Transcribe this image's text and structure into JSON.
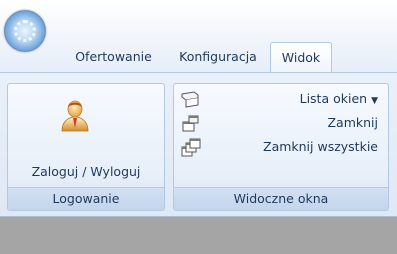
{
  "app": {
    "orb_icon": "app-orb-icon"
  },
  "tabs": [
    {
      "label": "Ofertowanie",
      "active": false
    },
    {
      "label": "Konfiguracja",
      "active": false
    },
    {
      "label": "Widok",
      "active": true
    }
  ],
  "groups": {
    "logowanie": {
      "title": "Logowanie",
      "button_label": "Zaloguj / Wyloguj",
      "icon": "user-icon"
    },
    "widoczne_okna": {
      "title": "Widoczne okna",
      "items": [
        {
          "label": "Lista okien",
          "icon": "window-list-icon",
          "has_dropdown": true
        },
        {
          "label": "Zamknij",
          "icon": "close-window-icon"
        },
        {
          "label": "Zamknij wszystkie",
          "icon": "close-all-windows-icon"
        }
      ]
    }
  },
  "colors": {
    "text": "#1e395b",
    "ribbon_bg": "#dfe8f5",
    "group_border": "#b4c8e0",
    "workspace": "#a5a5a5"
  }
}
